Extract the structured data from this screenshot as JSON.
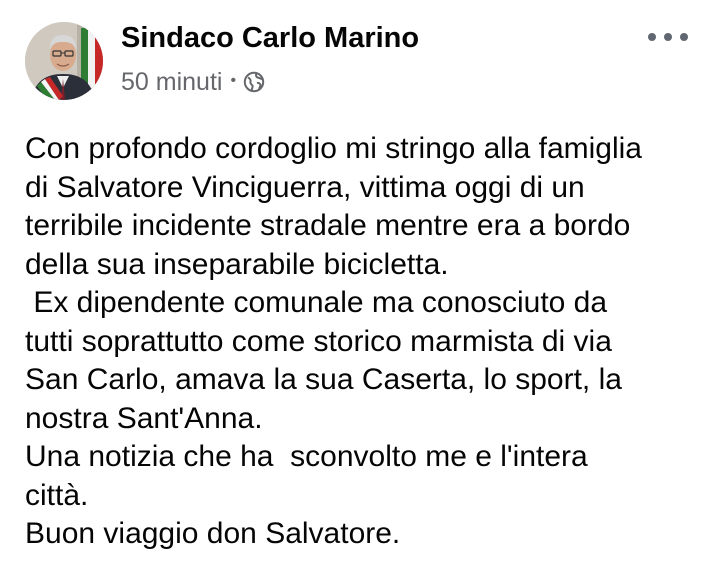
{
  "post": {
    "author": "Sindaco Carlo Marino",
    "time": "50 minuti",
    "separator": "•",
    "audience_icon": "globe-icon",
    "more_icon": "more-options-icon",
    "text_lines": [
      "Con profondo cordoglio mi stringo alla famiglia",
      "di Salvatore Vinciguerra, vittima oggi di un",
      "terribile incidente stradale mentre era a bordo",
      "della sua inseparabile bicicletta.",
      " Ex dipendente comunale ma conosciuto da",
      "tutti soprattutto come storico marmista di via",
      "San Carlo, amava la sua Caserta, lo sport, la",
      "nostra Sant'Anna.",
      "Una notizia che ha  sconvolto me e l'intera",
      "città.",
      "Buon viaggio don Salvatore."
    ]
  },
  "colors": {
    "text": "#050505",
    "secondary_text": "#65676b",
    "background": "#ffffff"
  }
}
